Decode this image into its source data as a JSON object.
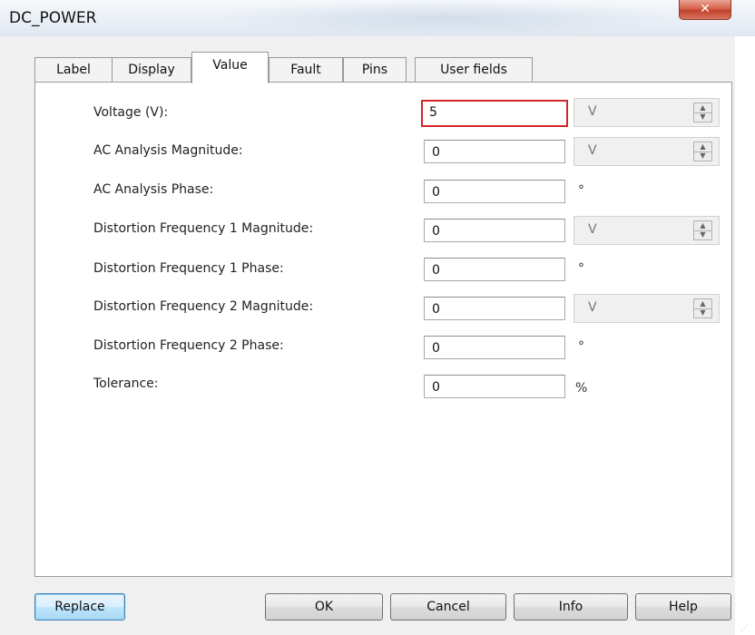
{
  "window": {
    "title": "DC_POWER",
    "close_glyph": "✕"
  },
  "tabs": [
    {
      "label": "Label",
      "active": false
    },
    {
      "label": "Display",
      "active": false
    },
    {
      "label": "Value",
      "active": true
    },
    {
      "label": "Fault",
      "active": false
    },
    {
      "label": "Pins",
      "active": false
    },
    {
      "label": "User fields",
      "active": false
    }
  ],
  "fields": [
    {
      "label": "Voltage (V):",
      "value": "5",
      "unit": "V",
      "unit_type": "dropdown-spinner",
      "focused": true
    },
    {
      "label": "AC Analysis Magnitude:",
      "value": "0",
      "unit": "V",
      "unit_type": "dropdown-spinner"
    },
    {
      "label": "AC Analysis Phase:",
      "value": "0",
      "unit": "°",
      "unit_type": "symbol"
    },
    {
      "label": "Distortion Frequency 1 Magnitude:",
      "value": "0",
      "unit": "V",
      "unit_type": "dropdown-spinner"
    },
    {
      "label": "Distortion Frequency 1 Phase:",
      "value": "0",
      "unit": "°",
      "unit_type": "symbol"
    },
    {
      "label": "Distortion Frequency 2 Magnitude:",
      "value": "0",
      "unit": "V",
      "unit_type": "dropdown-spinner"
    },
    {
      "label": "Distortion Frequency 2 Phase:",
      "value": "0",
      "unit": "°",
      "unit_type": "symbol"
    },
    {
      "label": "Tolerance:",
      "value": "0",
      "unit": "%",
      "unit_type": "symbol"
    }
  ],
  "buttons": {
    "replace": "Replace",
    "ok": "OK",
    "cancel": "Cancel",
    "info": "Info",
    "help": "Help"
  },
  "colors": {
    "focus_border": "#d32525",
    "default_button": "#bee6fd",
    "close_button": "#c94a34"
  }
}
